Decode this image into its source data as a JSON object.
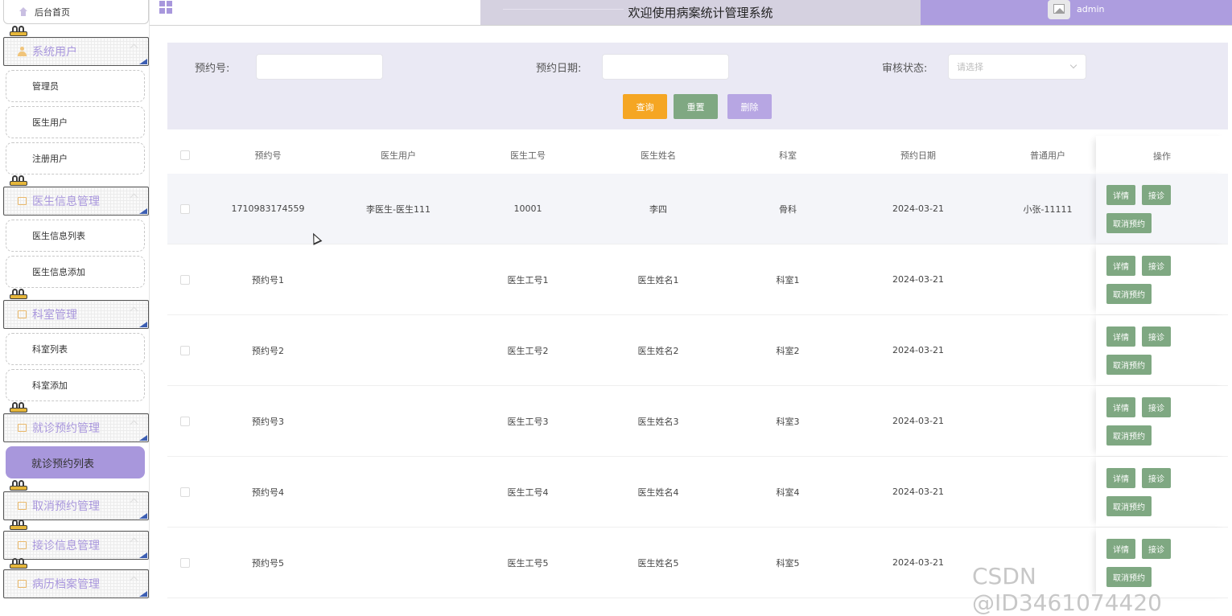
{
  "sidebar": {
    "home_label": "后台首页",
    "groups": [
      {
        "label": "系统用户",
        "items": [
          "管理员",
          "医生用户",
          "注册用户"
        ]
      },
      {
        "label": "医生信息管理",
        "items": [
          "医生信息列表",
          "医生信息添加"
        ]
      },
      {
        "label": "科室管理",
        "items": [
          "科室列表",
          "科室添加"
        ]
      },
      {
        "label": "就诊预约管理",
        "items": [
          "就诊预约列表"
        ]
      },
      {
        "label": "取消预约管理",
        "items": []
      },
      {
        "label": "接诊信息管理",
        "items": []
      },
      {
        "label": "病历档案管理",
        "items": []
      }
    ],
    "active_item": "就诊预约列表"
  },
  "header": {
    "title": "欢迎使用病案统计管理系统",
    "username": "admin"
  },
  "search": {
    "appointment_no_label": "预约号:",
    "appointment_no_value": "",
    "appointment_date_label": "预约日期:",
    "appointment_date_value": "",
    "review_status_label": "审核状态:",
    "review_status_placeholder": "请选择",
    "query_button": "查询",
    "reset_button": "重置",
    "delete_button": "删除"
  },
  "table": {
    "columns": [
      "预约号",
      "医生用户",
      "医生工号",
      "医生姓名",
      "科室",
      "预约日期",
      "普通用户",
      "操作"
    ],
    "rows": [
      [
        "1710983174559",
        "李医生-医生111",
        "10001",
        "李四",
        "骨科",
        "2024-03-21",
        "小张-11111"
      ],
      [
        "预约号1",
        "",
        "医生工号1",
        "医生姓名1",
        "科室1",
        "2024-03-21",
        ""
      ],
      [
        "预约号2",
        "",
        "医生工号2",
        "医生姓名2",
        "科室2",
        "2024-03-21",
        ""
      ],
      [
        "预约号3",
        "",
        "医生工号3",
        "医生姓名3",
        "科室3",
        "2024-03-21",
        ""
      ],
      [
        "预约号4",
        "",
        "医生工号4",
        "医生姓名4",
        "科室4",
        "2024-03-21",
        ""
      ],
      [
        "预约号5",
        "",
        "医生工号5",
        "医生姓名5",
        "科室5",
        "2024-03-21",
        ""
      ]
    ],
    "row_actions": {
      "detail": "详情",
      "accept": "接诊",
      "cancel": "取消预约"
    }
  },
  "colors": {
    "accent_purple": "#a897dc",
    "query_orange": "#f5a623",
    "action_green": "#7fa882",
    "delete_lavender": "#b7a6e3"
  },
  "watermark": "CSDN @ID3461074420"
}
